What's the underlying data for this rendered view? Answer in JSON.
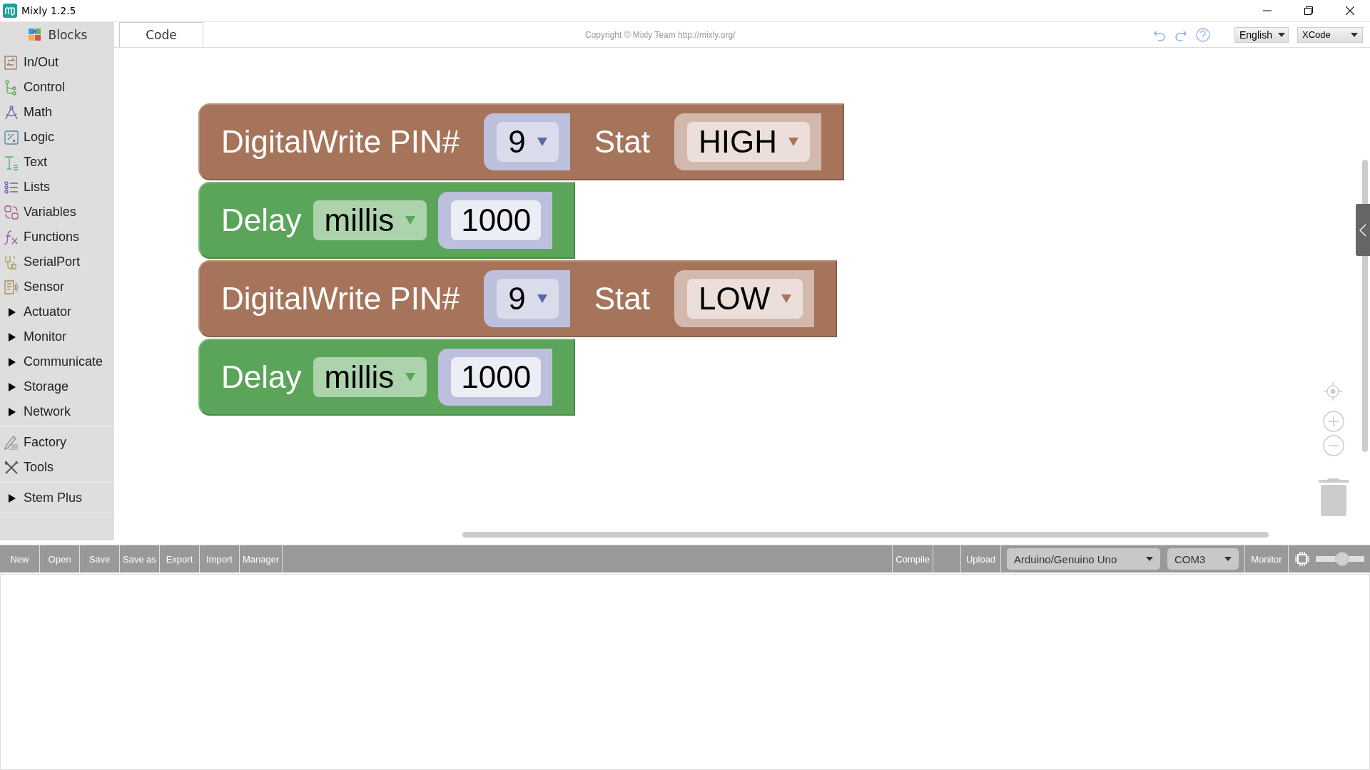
{
  "window": {
    "title": "Mixly 1.2.5"
  },
  "tabs": [
    {
      "label": "Blocks",
      "selected": true
    },
    {
      "label": "Code",
      "selected": false
    }
  ],
  "header": {
    "copyright": "Copyright © Mixly Team http://mixly.org/",
    "language": "English",
    "code_style": "XCode"
  },
  "sidebar": {
    "groups": [
      [
        {
          "label": "In/Out",
          "kind": "category"
        },
        {
          "label": "Control",
          "kind": "category"
        },
        {
          "label": "Math",
          "kind": "category"
        },
        {
          "label": "Logic",
          "kind": "category"
        },
        {
          "label": "Text",
          "kind": "category"
        },
        {
          "label": "Lists",
          "kind": "category"
        },
        {
          "label": "Variables",
          "kind": "category"
        },
        {
          "label": "Functions",
          "kind": "category"
        },
        {
          "label": "SerialPort",
          "kind": "category"
        },
        {
          "label": "Sensor",
          "kind": "category"
        },
        {
          "label": "Actuator",
          "kind": "folder"
        },
        {
          "label": "Monitor",
          "kind": "folder"
        },
        {
          "label": "Communicate",
          "kind": "folder"
        },
        {
          "label": "Storage",
          "kind": "folder"
        },
        {
          "label": "Network",
          "kind": "folder"
        }
      ],
      [
        {
          "label": "Factory",
          "kind": "factory"
        },
        {
          "label": "Tools",
          "kind": "tools"
        }
      ],
      [
        {
          "label": "Stem Plus",
          "kind": "folder"
        }
      ]
    ]
  },
  "blocks": [
    {
      "kind": "digital_write",
      "label": "DigitalWrite PIN#",
      "pin": "9",
      "stat_label": "Stat",
      "stat": "HIGH"
    },
    {
      "kind": "delay",
      "label": "Delay",
      "unit": "millis",
      "value": "1000"
    },
    {
      "kind": "digital_write",
      "label": "DigitalWrite PIN#",
      "pin": "9",
      "stat_label": "Stat",
      "stat": "LOW"
    },
    {
      "kind": "delay",
      "label": "Delay",
      "unit": "millis",
      "value": "1000"
    }
  ],
  "toolbar": {
    "file_buttons": [
      "New",
      "Open",
      "Save",
      "Save as",
      "Export",
      "Import",
      "Manager"
    ],
    "compile": "Compile",
    "upload": "Upload",
    "board": "Arduino/Genuino Uno",
    "port": "COM3",
    "monitor": "Monitor",
    "speed_slider": {
      "level": 0.55
    }
  }
}
